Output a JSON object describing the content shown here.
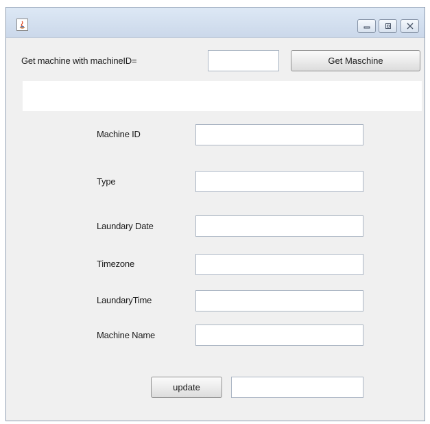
{
  "window": {
    "controls": [
      "minimize-icon",
      "maximize-icon",
      "close-icon"
    ]
  },
  "query": {
    "label": "Get machine with machineID=",
    "machine_id_value": "",
    "get_button_label": "Get Maschine"
  },
  "result": {
    "text": ""
  },
  "form": {
    "machine_id_label": "Machine ID",
    "machine_id_value": "",
    "type_label": "Type",
    "type_value": "",
    "laundary_date_label": "Laundary Date",
    "laundary_date_value": "",
    "timezone_label": "Timezone",
    "timezone_value": "",
    "laundary_time_label": "LaundaryTime",
    "laundary_time_value": "",
    "machine_name_label": "Machine Name",
    "machine_name_value": ""
  },
  "footer": {
    "update_button_label": "update",
    "status_value": ""
  }
}
